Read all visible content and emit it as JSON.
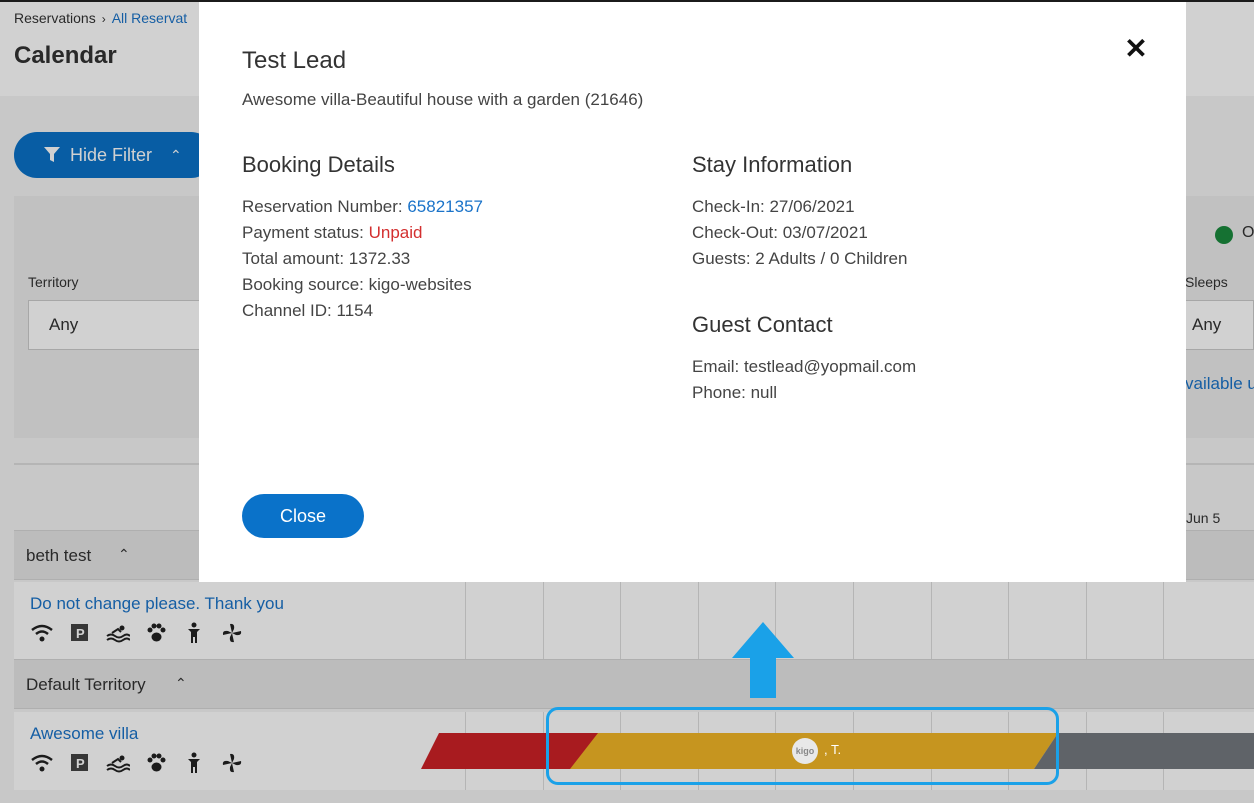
{
  "breadcrumb": {
    "root": "Reservations",
    "current": "All Reservat"
  },
  "page_title": "Calendar",
  "filter": {
    "hide_filter_label": "Hide Filter",
    "territory_label": "Territory",
    "territory_value": "Any",
    "sleeps_label": "Sleeps",
    "sleeps_value": "Any",
    "legend_text": "O",
    "available_link": "vailable u"
  },
  "calendar": {
    "date_label": "Jun 5",
    "groups": [
      {
        "label": "beth test",
        "property": "Do not change please. Thank you"
      },
      {
        "label": "Default Territory",
        "property": "Awesome villa"
      }
    ],
    "reservation_label": ", T.",
    "logo_text": "kigo",
    "colors": {
      "cancelled": "#a81b1f",
      "booked": "#c6951f",
      "blocked": "#5f6368"
    }
  },
  "modal": {
    "title": "Test Lead",
    "subtitle": "Awesome villa-Beautiful house with a garden (21646)",
    "booking_details": {
      "heading": "Booking Details",
      "reservation_number_label": "Reservation Number: ",
      "reservation_number": "65821357",
      "payment_status_label": "Payment status: ",
      "payment_status": "Unpaid",
      "total_amount": "Total amount: 1372.33",
      "booking_source": "Booking source: kigo-websites",
      "channel_id": "Channel ID: 1154"
    },
    "stay_information": {
      "heading": "Stay Information",
      "check_in": "Check-In: 27/06/2021",
      "check_out": "Check-Out: 03/07/2021",
      "guests": "Guests: 2 Adults / 0 Children"
    },
    "guest_contact": {
      "heading": "Guest Contact",
      "email": "Email: testlead@yopmail.com",
      "phone": "Phone: null"
    },
    "close_label": "Close",
    "close_icon": "close-icon"
  }
}
